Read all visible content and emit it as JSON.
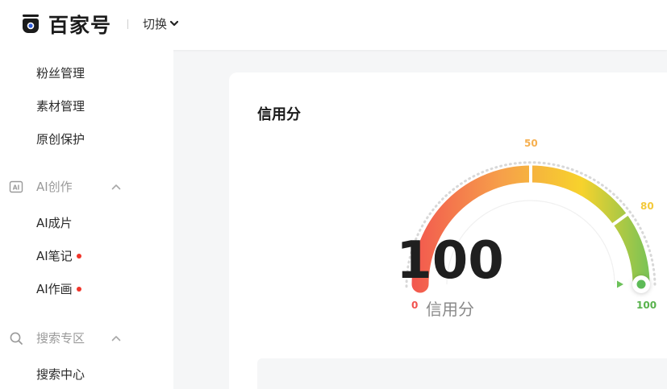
{
  "header": {
    "logo_text": "百家号",
    "switch_label": "切换",
    "logo_icon": "baijiahao-logo-icon"
  },
  "sidebar": {
    "items_top": [
      {
        "label": "粉丝管理"
      },
      {
        "label": "素材管理"
      },
      {
        "label": "原创保护"
      }
    ],
    "groups": [
      {
        "label": "AI创作",
        "icon": "ai-icon",
        "expanded": true,
        "items": [
          {
            "label": "AI成片",
            "new": false
          },
          {
            "label": "AI笔记",
            "new": true
          },
          {
            "label": "AI作画",
            "new": true
          }
        ]
      },
      {
        "label": "搜索专区",
        "icon": "search-icon",
        "expanded": true,
        "items": [
          {
            "label": "搜索中心",
            "new": false
          }
        ]
      }
    ]
  },
  "credit": {
    "title": "信用分",
    "score": "100",
    "score_label": "信用分",
    "value": 100,
    "min": 0,
    "max": 100,
    "ticks": {
      "t0": "0",
      "t50": "50",
      "t80": "80",
      "t100": "100"
    },
    "colors": {
      "red": "#f2524f",
      "orange": "#f6a04a",
      "yellow": "#f7d22c",
      "green": "#6cc15a"
    }
  }
}
